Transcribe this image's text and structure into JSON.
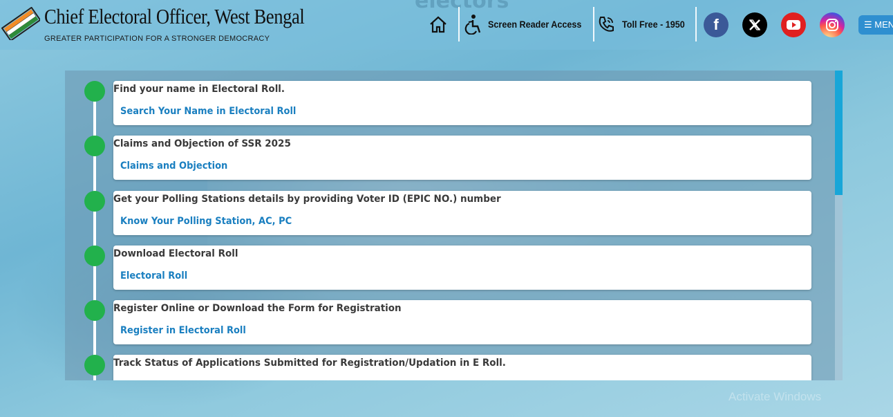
{
  "header": {
    "bg_word": "electors",
    "title": "Chief Electoral Officer, West Bengal",
    "tagline": "GREATER PARTICIPATION FOR A STRONGER DEMOCRACY",
    "screen_reader": "Screen Reader Access",
    "toll_free": "Toll Free - 1950",
    "menu": "☰ MENU"
  },
  "social": {
    "facebook_color": "#3b5998",
    "x_color": "#000000",
    "youtube_color": "#e02020",
    "instagram_color": "#d62976"
  },
  "items": [
    {
      "title": "Find your name in Electoral Roll.",
      "link": "Search Your Name in Electoral Roll"
    },
    {
      "title": "Claims and Objection of SSR 2025",
      "link": "Claims and Objection"
    },
    {
      "title": "Get your Polling Stations details by providing Voter ID (EPIC NO.) number",
      "link": "Know Your Polling Station, AC, PC"
    },
    {
      "title": "Download Electoral Roll",
      "link": "Electoral Roll"
    },
    {
      "title": "Register Online or Download the Form for Registration",
      "link": "Register in Electoral Roll"
    },
    {
      "title": "Track Status of Applications Submitted for Registration/Updation in E Roll.",
      "link": ""
    }
  ],
  "watermark": "Activate Windows",
  "colors": {
    "accent_link": "#1a7fc0",
    "timeline_dot": "#22b14c",
    "scroll_thumb": "#18a6d8"
  }
}
